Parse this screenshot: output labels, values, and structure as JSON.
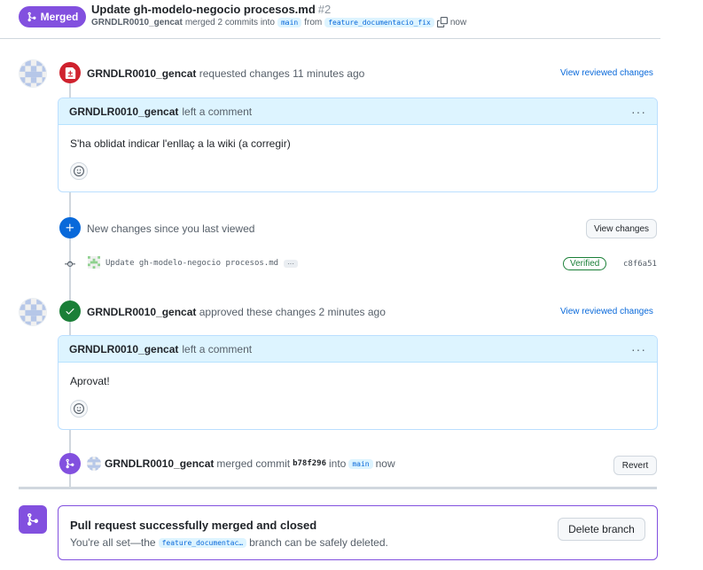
{
  "header": {
    "status_badge": "Merged",
    "title": "Update gh-modelo-negocio procesos.md",
    "number": "#2",
    "author": "GRNDLR0010_gencat",
    "merged_text": "merged 2 commits into",
    "base_branch": "main",
    "from_text": "from",
    "head_branch": "feature_documentacio_fix",
    "time": "now"
  },
  "review1": {
    "author": "GRNDLR0010_gencat",
    "action": "requested changes 11 minutes ago",
    "link": "View reviewed changes",
    "comment_author": "GRNDLR0010_gencat",
    "comment_action": "left a comment",
    "menu": "···",
    "body": "S'ha oblidat indicar l'enllaç a la wiki (a corregir)"
  },
  "new_changes": {
    "text": "New changes since you last viewed",
    "button": "View changes"
  },
  "commit": {
    "message": "Update gh-modelo-negocio procesos.md",
    "more": "···",
    "verified": "Verified",
    "sha": "c8f6a51"
  },
  "review2": {
    "author": "GRNDLR0010_gencat",
    "action": "approved these changes 2 minutes ago",
    "link": "View reviewed changes",
    "comment_author": "GRNDLR0010_gencat",
    "comment_action": "left a comment",
    "menu": "···",
    "body": "Aprovat!"
  },
  "merge_event": {
    "author": "GRNDLR0010_gencat",
    "text": "merged commit",
    "sha": "b78f296",
    "into": "into",
    "branch": "main",
    "time": "now",
    "button": "Revert"
  },
  "merged_box": {
    "title": "Pull request successfully merged and closed",
    "sub_pre": "You're all set—the",
    "branch": "feature_documentac…",
    "sub_post": "branch can be safely deleted.",
    "button": "Delete branch"
  },
  "colors": {
    "merged": "#8250df",
    "changes_requested": "#cf222e",
    "approved": "#1a7f37",
    "info": "#0969da"
  }
}
